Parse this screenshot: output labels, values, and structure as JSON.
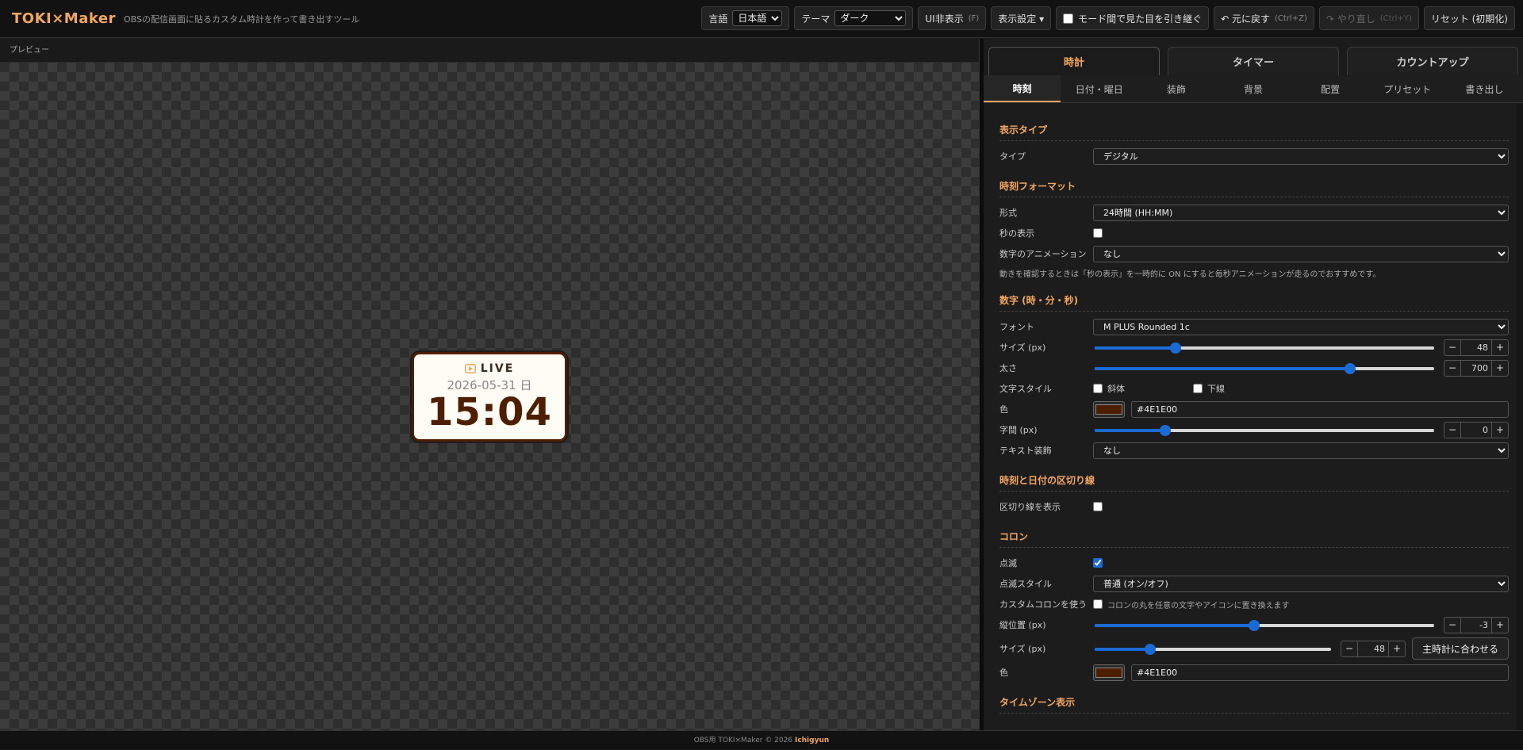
{
  "header": {
    "logo": "TOKI×Maker",
    "subtitle": "OBSの配信画面に貼るカスタム時計を作って書き出すツール",
    "language_label": "言語",
    "language_value": "日本語",
    "theme_label": "テーマ",
    "theme_value": "ダーク",
    "hide_ui_label": "UI非表示",
    "hide_ui_key": "(F)",
    "display_settings_label": "表示設定 ▾",
    "inherit_look_label": "モード間で見た目を引き継ぐ",
    "undo_label": "↶ 元に戻す",
    "undo_key": "(Ctrl+Z)",
    "redo_label": "↷ やり直し",
    "redo_key": "(Ctrl+Y)",
    "reset_label": "リセット (初期化)"
  },
  "preview": {
    "label": "プレビュー",
    "live_text": "LIVE",
    "date_text": "2026-05-31 日",
    "time_text": "15:04"
  },
  "tabs": {
    "main": [
      "時計",
      "タイマー",
      "カウントアップ"
    ],
    "sub": [
      "時刻",
      "日付・曜日",
      "装飾",
      "背景",
      "配置",
      "プリセット",
      "書き出し"
    ]
  },
  "settings": {
    "display_type": {
      "title": "表示タイプ",
      "type_label": "タイプ",
      "type_value": "デジタル"
    },
    "time_format": {
      "title": "時刻フォーマット",
      "format_label": "形式",
      "format_value": "24時間 (HH:MM)",
      "seconds_label": "秒の表示",
      "animation_label": "数字のアニメーション",
      "animation_value": "なし",
      "note": "動きを確認するときは「秒の表示」を一時的に ON にすると毎秒アニメーションが走るのでおすすめです。"
    },
    "digits": {
      "title": "数字 (時・分・秒)",
      "font_label": "フォント",
      "font_value": "M PLUS Rounded 1c",
      "size_label": "サイズ (px)",
      "size_value": "48",
      "size_fraction": 0.24,
      "weight_label": "太さ",
      "weight_value": "700",
      "weight_fraction": 0.75,
      "style_label": "文字スタイル",
      "italic_label": "斜体",
      "underline_label": "下線",
      "color_label": "色",
      "color_value": "#4E1E00",
      "spacing_label": "字間 (px)",
      "spacing_value": "0",
      "spacing_fraction": 0.21,
      "decoration_label": "テキスト装飾",
      "decoration_value": "なし"
    },
    "divider": {
      "title": "時刻と日付の区切り線",
      "show_label": "区切り線を表示"
    },
    "colon": {
      "title": "コロン",
      "blink_label": "点滅",
      "blink_style_label": "点滅スタイル",
      "blink_style_value": "普通 (オン/オフ)",
      "custom_label": "カスタムコロンを使う",
      "custom_note": "コロンの丸を任意の文字やアイコンに置き換えます",
      "offset_label": "縦位置 (px)",
      "offset_value": "-3",
      "offset_fraction": 0.47,
      "size_label": "サイズ (px)",
      "size_value": "48",
      "size_fraction": 0.24,
      "fit_button": "主時計に合わせる",
      "color_label": "色",
      "color_value": "#4E1E00"
    },
    "timezone": {
      "title": "タイムゾーン表示"
    }
  },
  "footer": {
    "text": "OBS用 TOKI×Maker © 2026",
    "author": "Ichigyun"
  },
  "colors": {
    "accent": "#f2a660",
    "clock_text": "#4E1E00",
    "slider": "#1b6bd6"
  }
}
